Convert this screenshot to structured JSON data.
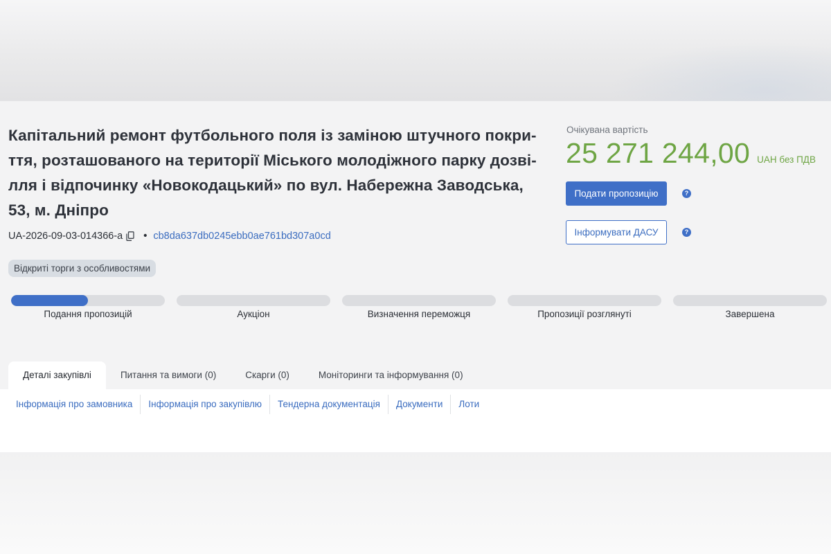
{
  "tender": {
    "title": "Капітальний ремонт футбольного поля із заміною штучного покриття, розташованого на території Міського молодіжного парку дозвілля і відпочинку «Новокодацький» по вул. Набережна Заводська, 53, м. Дніпро",
    "title_lines": [
      "Капітальний ремонт футбольного поля із заміною штучного покри-",
      "ття, розташованого на території Міського молодіжного парку дозві-",
      "лля і відпочинку «Новокодацький» по вул. Набережна Заводська,",
      "53, м. Дніпро"
    ],
    "id": "UA-2026-09-03-014366-a",
    "hash": "cb8da637db0245ebb0ae761bd307a0cd",
    "procedure_badge": "Відкриті торги з особливостями"
  },
  "price": {
    "label": "Очікувана вартість",
    "value": "25 271 244,00",
    "currency": "UAH без ПДВ"
  },
  "actions": {
    "submit_label": "Подати пропозицію",
    "inform_label": "Інформувати ДАСУ",
    "help_glyph": "?"
  },
  "stages": [
    {
      "label": "Подання пропозицій",
      "progress": 0.5
    },
    {
      "label": "Аукціон",
      "progress": 0
    },
    {
      "label": "Визначення переможця",
      "progress": 0
    },
    {
      "label": "Пропозиції розглянуті",
      "progress": 0
    },
    {
      "label": "Завершена",
      "progress": 0
    }
  ],
  "tabs": [
    {
      "label": "Деталі закупівлі",
      "active": true
    },
    {
      "label": "Питання та вимоги (0)",
      "active": false
    },
    {
      "label": "Скарги (0)",
      "active": false
    },
    {
      "label": "Моніторинги та інформування (0)",
      "active": false
    }
  ],
  "subnav": [
    "Інформація про замовника",
    "Інформація про закупівлю",
    "Тендерна документація",
    "Документи",
    "Лоти"
  ],
  "icons": {
    "copy": "copy-icon",
    "help": "question-circle-icon"
  },
  "colors": {
    "accent": "#3f6fc7",
    "price": "#6ea544",
    "badge_bg": "#d8dde3"
  }
}
